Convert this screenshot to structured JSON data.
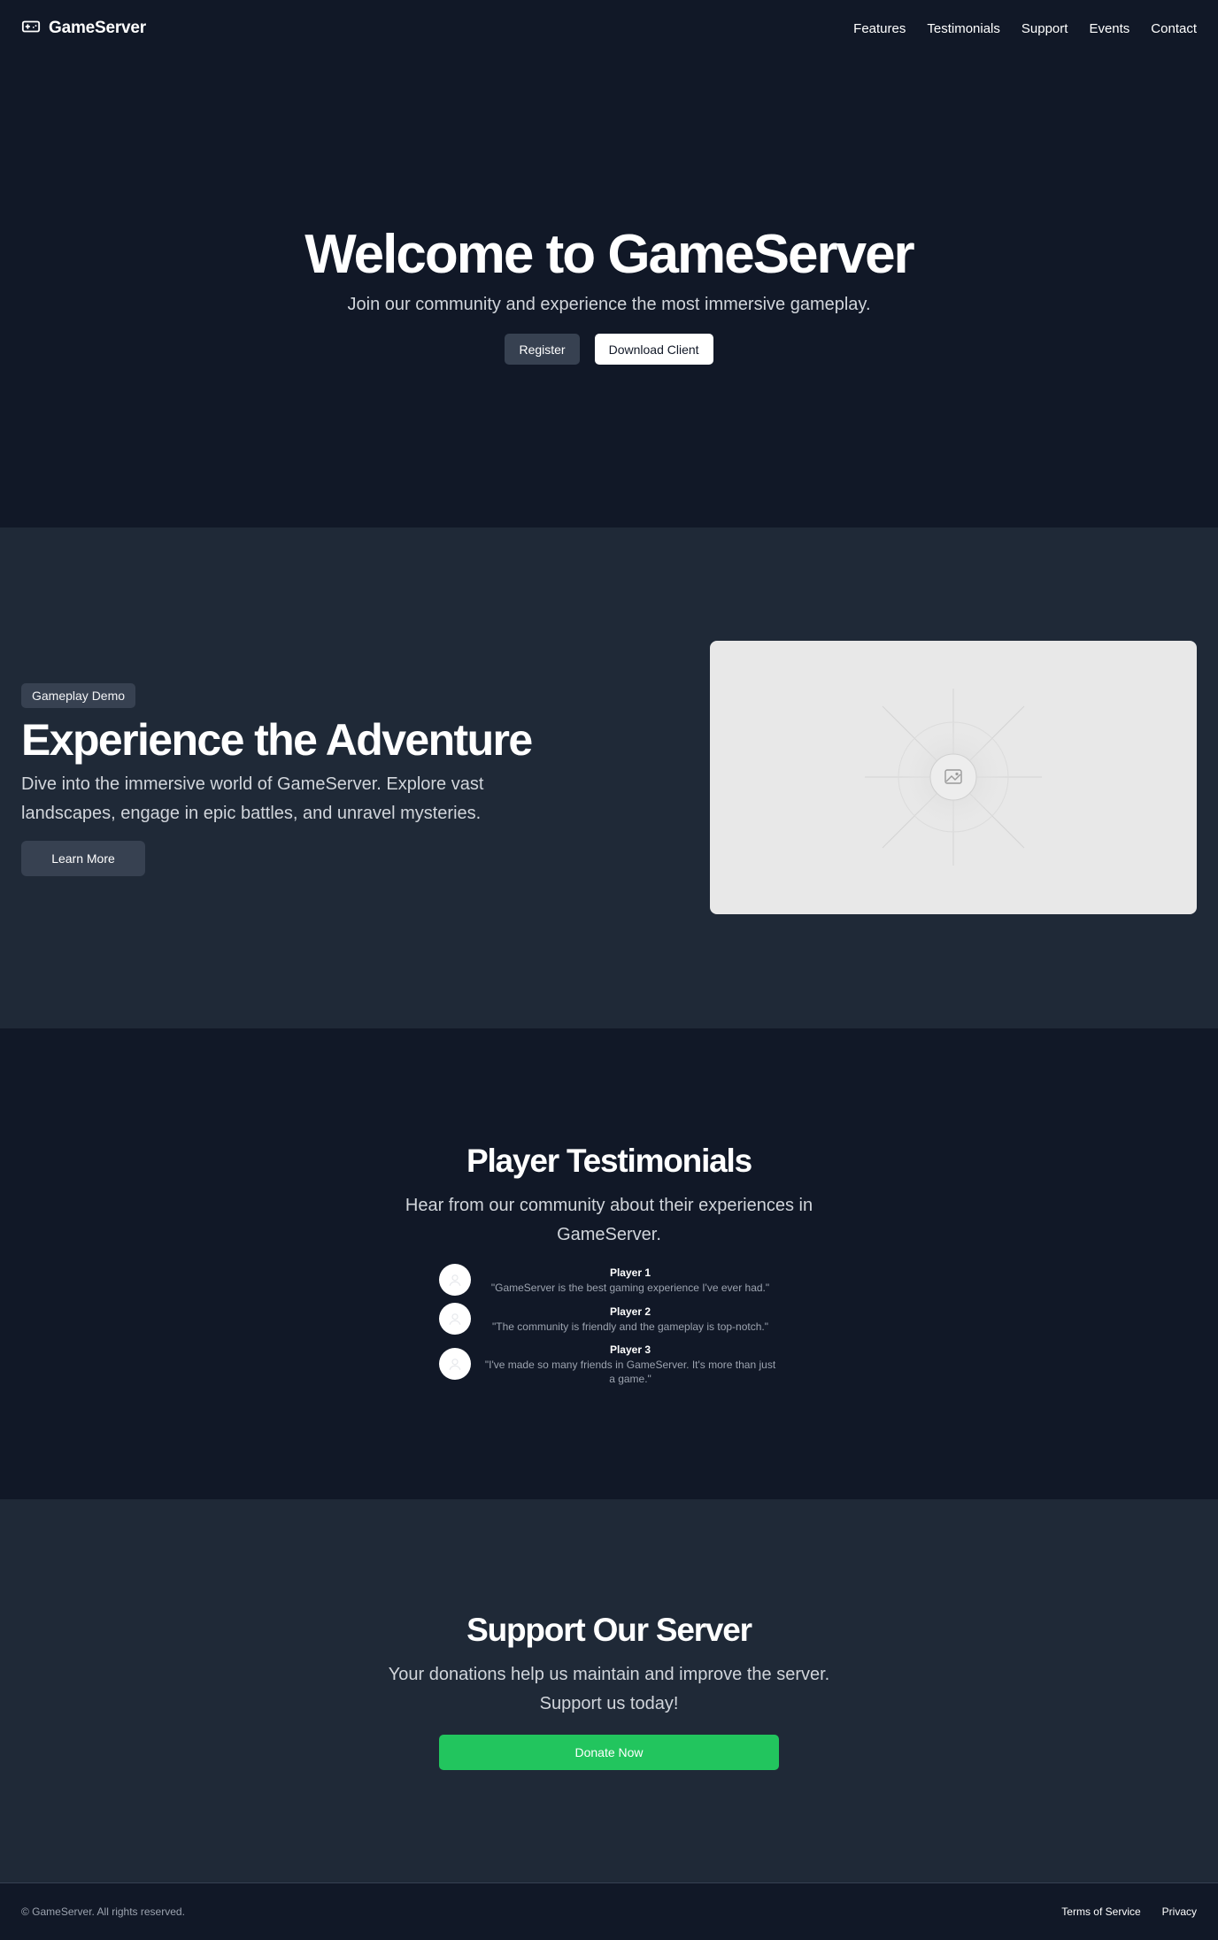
{
  "header": {
    "brand": "GameServer",
    "logo_icon": "gamepad-icon",
    "nav": [
      "Features",
      "Testimonials",
      "Support",
      "Events",
      "Contact"
    ]
  },
  "hero": {
    "title": "Welcome to GameServer",
    "subtitle": "Join our community and experience the most immersive gameplay.",
    "register_label": "Register",
    "download_label": "Download Client"
  },
  "demo": {
    "badge": "Gameplay Demo",
    "title": "Experience the Adventure",
    "text": "Dive into the immersive world of GameServer. Explore vast landscapes, engage in epic battles, and unravel mysteries.",
    "button_label": "Learn More",
    "image_icon": "image-placeholder-icon"
  },
  "testimonials": {
    "title": "Player Testimonials",
    "subtitle": "Hear from our community about their experiences in GameServer.",
    "items": [
      {
        "name": "Player 1",
        "quote": "\"GameServer is the best gaming experience I've ever had.\""
      },
      {
        "name": "Player 2",
        "quote": "\"The community is friendly and the gameplay is top-notch.\""
      },
      {
        "name": "Player 3",
        "quote": "\"I've made so many friends in GameServer. It's more than just a game.\""
      }
    ]
  },
  "support": {
    "title": "Support Our Server",
    "subtitle": "Your donations help us maintain and improve the server. Support us today!",
    "button_label": "Donate Now"
  },
  "footer": {
    "copyright": "© GameServer. All rights reserved.",
    "links": [
      "Terms of Service",
      "Privacy"
    ]
  },
  "colors": {
    "background": "#111827",
    "section_alt": "#1f2937",
    "button_dark": "#374151",
    "donate_green": "#22c55e"
  }
}
